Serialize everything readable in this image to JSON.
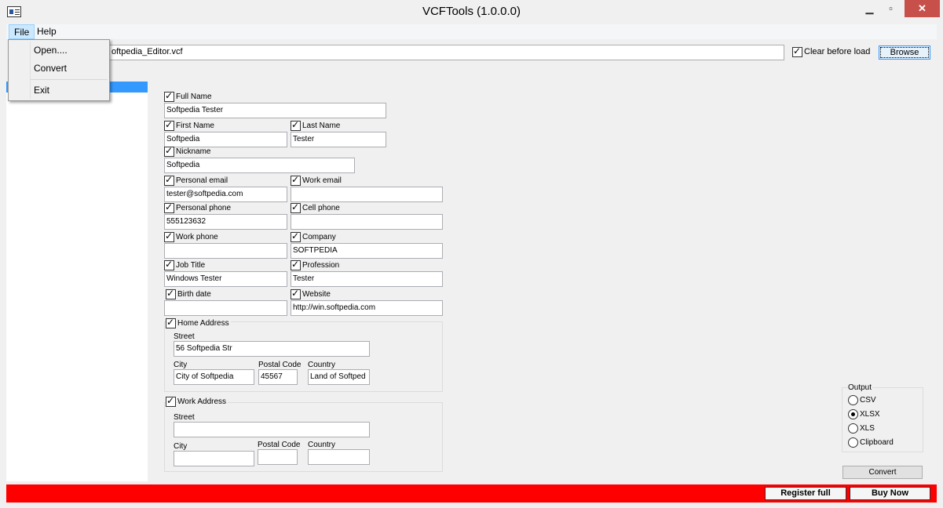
{
  "window": {
    "title": "VCFTools (1.0.0.0)",
    "minimize": "▁",
    "maximize": "▫",
    "close": "✕"
  },
  "menubar": {
    "file": "File",
    "help": "Help"
  },
  "file_menu": {
    "open": "Open....",
    "convert": "Convert",
    "exit": "Exit"
  },
  "toolbar": {
    "path_value": "oftpedia_Editor.vcf",
    "clear_label": "Clear before load",
    "clear_checked": true,
    "browse": "Browse"
  },
  "form": {
    "full_name": {
      "label": "Full Name",
      "value": "Softpedia Tester"
    },
    "first_name": {
      "label": "First Name",
      "value": "Softpedia"
    },
    "last_name": {
      "label": "Last Name",
      "value": "Tester"
    },
    "nickname": {
      "label": "Nickname",
      "value": "Softpedia"
    },
    "personal_email": {
      "label": "Personal email",
      "value": "tester@softpedia.com"
    },
    "work_email": {
      "label": "Work email",
      "value": ""
    },
    "personal_phone": {
      "label": "Personal phone",
      "value": "555123632"
    },
    "cell_phone": {
      "label": "Cell phone",
      "value": ""
    },
    "work_phone": {
      "label": "Work phone",
      "value": ""
    },
    "company": {
      "label": "Company",
      "value": "SOFTPEDIA"
    },
    "job_title": {
      "label": "Job Title",
      "value": "Windows Tester"
    },
    "profession": {
      "label": "Profession",
      "value": "Tester"
    },
    "birth_date": {
      "label": "Birth date",
      "value": ""
    },
    "website": {
      "label": "Website",
      "value": "http://win.softpedia.com"
    },
    "home_address": {
      "label": "Home Address",
      "street_label": "Street",
      "street": "56 Softpedia Str",
      "city_label": "City",
      "city": "City of Softpedia",
      "postal_label": "Postal Code",
      "postal": "45567",
      "country_label": "Country",
      "country": "Land of Softped"
    },
    "work_address": {
      "label": "Work Address",
      "street_label": "Street",
      "street": "",
      "city_label": "City",
      "city": "",
      "postal_label": "Postal Code",
      "postal": "",
      "country_label": "Country",
      "country": ""
    }
  },
  "output": {
    "title": "Output",
    "options": [
      "CSV",
      "XLSX",
      "XLS",
      "Clipboard"
    ],
    "selected": "XLSX"
  },
  "convert_button": "Convert",
  "status": {
    "register": "Register full",
    "buy": "Buy Now"
  },
  "colors": {
    "status_bar": "#ff0000",
    "selection": "#3399ff",
    "close_button": "#c7504a"
  }
}
